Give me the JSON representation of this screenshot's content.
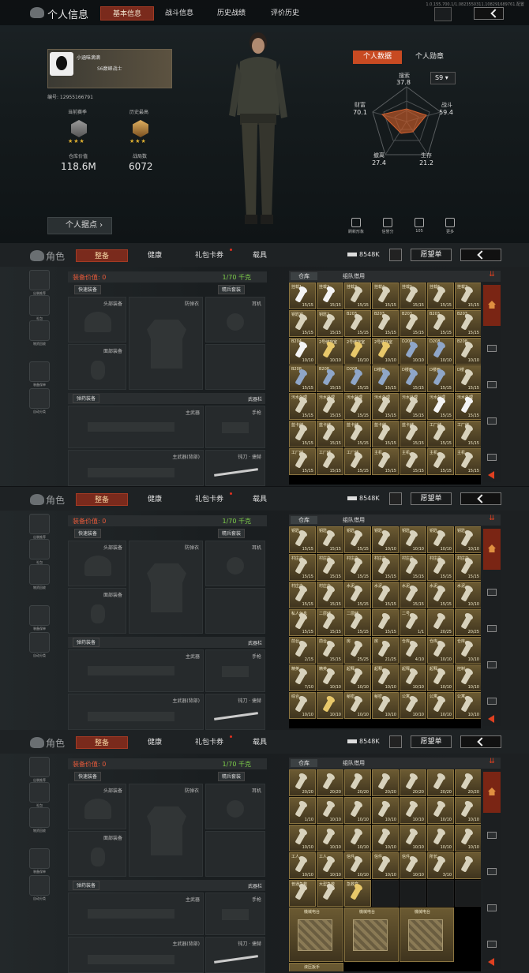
{
  "profile": {
    "title": "个人信息",
    "tabs": [
      "基本信息",
      "战斗信息",
      "历史战绩",
      "评价历史"
    ],
    "sys_info": "1.0.155.700.1/1.0823550311.108291689761.配置",
    "player_name": "小涵味滴滴",
    "player_badge": "S6巅峰战士",
    "player_id": "编号: 12955166791",
    "season_label": "当前赛季",
    "best_label": "历史最高",
    "asset_label": "仓库价值",
    "asset_value": "118.6M",
    "kills_label": "战局数",
    "kills_value": "6072",
    "stars": "★★★",
    "data_tabs": [
      "个人数据",
      "个人勋章"
    ],
    "season_select": "S9",
    "radar": {
      "search_label": "搜索",
      "search_value": "37.8",
      "combat_label": "战斗",
      "combat_value": "59.4",
      "survive_label": "生存",
      "survive_value": "21.2",
      "evac_label": "撤离",
      "evac_value": "27.4",
      "wealth_label": "财富",
      "wealth_value": "70.1"
    },
    "stronghold_btn": "个人据点",
    "quick": [
      {
        "label": "刷新形象",
        "icon": "refresh-icon"
      },
      {
        "label": "信誉分",
        "icon": "shield-icon"
      },
      {
        "label": "105",
        "icon": "thumb-up-icon"
      },
      {
        "label": "更多",
        "icon": "grid-icon"
      }
    ]
  },
  "inventory": {
    "role_title": "角色",
    "tabs": [
      "整备",
      "健康",
      "礼包卡券",
      "载具"
    ],
    "money": "8548K",
    "wish_btn": "愿望单",
    "side": [
      "出装推荐",
      "礼包",
      "物资回收",
      "装备保单",
      "自动分类"
    ],
    "equip_value": "装备价值: 0",
    "weight": "1/70 千克",
    "quick_equip": "快速装备",
    "elite_equip": "精兵套装",
    "slots": {
      "helmet": "头部装备",
      "armor": "防弹衣",
      "ear": "耳机",
      "face": "面部装备",
      "ammo": "弹药装备",
      "weapon_bar": "武器栏",
      "primary": "主武器",
      "pistol": "手枪",
      "primary2": "主武器(背部)",
      "melee": "钝刀 · 捷赫"
    },
    "storage_tabs": [
      "仓库",
      "组队借用"
    ]
  },
  "panels": [
    {
      "items": [
        [
          "挂载1",
          "15/15",
          "white"
        ],
        [
          "挂载2",
          "15/15",
          "white"
        ],
        [
          "挂载3",
          "15/15",
          ""
        ],
        [
          "挂载4",
          "15/15",
          ""
        ],
        [
          "挂载5",
          "15/15",
          ""
        ],
        [
          "挂载6",
          "15/15",
          ""
        ],
        [
          "挂载7",
          "15/15",
          ""
        ],
        [
          "钥匙室",
          "15/15",
          ""
        ],
        [
          "钥匙2",
          "15/15",
          ""
        ],
        [
          "B203",
          "15/15",
          ""
        ],
        [
          "B203",
          "15/15",
          ""
        ],
        [
          "B203",
          "15/15",
          ""
        ],
        [
          "B203",
          "15/15",
          ""
        ],
        [
          "B203",
          "15/15",
          ""
        ],
        [
          "B204",
          "10/10",
          "white"
        ],
        [
          "2号储存室",
          "10/10",
          "yellow"
        ],
        [
          "2号储存室",
          "10/10",
          "yellow"
        ],
        [
          "2号储存室",
          "10/10",
          "yellow"
        ],
        [
          "D208",
          "10/10",
          "blue"
        ],
        [
          "D208",
          "10/10",
          "blue"
        ],
        [
          "B208",
          "10/10",
          ""
        ],
        [
          "B208",
          "15/15",
          "blue"
        ],
        [
          "B208",
          "15/15",
          "blue"
        ],
        [
          "D208",
          "15/15",
          "blue"
        ],
        [
          "D楼西",
          "15/15",
          "blue"
        ],
        [
          "D楼西",
          "15/15",
          "blue"
        ],
        [
          "D楼西",
          "15/15",
          "blue"
        ],
        [
          "D楼",
          "15/15",
          ""
        ],
        [
          "污水处理",
          "15/15",
          ""
        ],
        [
          "污水处理",
          "15/15",
          ""
        ],
        [
          "污水处理",
          "15/15",
          ""
        ],
        [
          "污水处理",
          "15/15",
          ""
        ],
        [
          "污水处理",
          "15/15",
          ""
        ],
        [
          "污水处理",
          "15/15",
          "white"
        ],
        [
          "污水处理",
          "15/15",
          "white"
        ],
        [
          "蓝卡储",
          "15/15",
          ""
        ],
        [
          "蓝卡储",
          "15/15",
          ""
        ],
        [
          "蓝卡储",
          "15/15",
          ""
        ],
        [
          "蓝卡储",
          "15/15",
          ""
        ],
        [
          "蓝卡储",
          "15/15",
          ""
        ],
        [
          "工厂储",
          "15/15",
          ""
        ],
        [
          "工厂储",
          "15/15",
          ""
        ],
        [
          "工厂储",
          "15/15",
          ""
        ],
        [
          "工厂储",
          "15/15",
          ""
        ],
        [
          "工厂储",
          "15/15",
          ""
        ],
        [
          "主机",
          "15/15",
          ""
        ],
        [
          "主机",
          "15/15",
          ""
        ],
        [
          "主机",
          "15/15",
          ""
        ],
        [
          "主机",
          "15/15",
          ""
        ]
      ]
    },
    {
      "items": [
        [
          "钥匙",
          "15/15",
          ""
        ],
        [
          "钥匙",
          "15/15",
          ""
        ],
        [
          "钥匙",
          "15/15",
          ""
        ],
        [
          "钥匙",
          "10/10",
          ""
        ],
        [
          "钥匙",
          "10/10",
          ""
        ],
        [
          "钥匙",
          "10/10",
          ""
        ],
        [
          "钥匙",
          "10/10",
          ""
        ],
        [
          "村庄办",
          "15/15",
          ""
        ],
        [
          "村庄办",
          "15/15",
          ""
        ],
        [
          "村庄办",
          "15/15",
          ""
        ],
        [
          "村庄办",
          "15/15",
          ""
        ],
        [
          "村庄办",
          "15/15",
          ""
        ],
        [
          "村庄办",
          "15/15",
          ""
        ],
        [
          "村庄办",
          "15/15",
          ""
        ],
        [
          "村庄办",
          "15/15",
          ""
        ],
        [
          "村庄办",
          "15/15",
          ""
        ],
        [
          "水泥",
          "15/15",
          ""
        ],
        [
          "水泥",
          "15/15",
          ""
        ],
        [
          "水泥",
          "15/15",
          ""
        ],
        [
          "水泥",
          "15/15",
          ""
        ],
        [
          "水泥",
          "10/10",
          ""
        ],
        [
          "私人休息",
          "15/15",
          ""
        ],
        [
          "二层储",
          "15/15",
          ""
        ],
        [
          "二层储",
          "15/15",
          ""
        ],
        [
          "",
          "15/15",
          ""
        ],
        [
          "二号",
          "1/1",
          ""
        ],
        [
          "",
          "20/25",
          ""
        ],
        [
          "",
          "20/25",
          ""
        ],
        [
          "前台",
          "2/15",
          ""
        ],
        [
          "前台",
          "15/15",
          ""
        ],
        [
          "房",
          "25/25",
          ""
        ],
        [
          "房",
          "21/25",
          ""
        ],
        [
          "仓库",
          "4/10",
          ""
        ],
        [
          "仓库",
          "10/10",
          ""
        ],
        [
          "仓库",
          "10/10",
          ""
        ],
        [
          "精英",
          "7/10",
          ""
        ],
        [
          "精英",
          "10/10",
          ""
        ],
        [
          "起释",
          "10/10",
          ""
        ],
        [
          "起释",
          "10/10",
          ""
        ],
        [
          "起释",
          "10/10",
          ""
        ],
        [
          "起释",
          "10/10",
          ""
        ],
        [
          "控制",
          "10/10",
          ""
        ],
        [
          "综合",
          "10/10",
          ""
        ],
        [
          "",
          "10/10",
          "yellow"
        ],
        [
          "秘密",
          "10/10",
          ""
        ],
        [
          "秘密",
          "10/10",
          ""
        ],
        [
          "公寓",
          "10/10",
          ""
        ],
        [
          "公寓",
          "10/10",
          ""
        ],
        [
          "公寓",
          "10/10",
          ""
        ]
      ]
    },
    {
      "items": [
        [
          "",
          "20/20",
          ""
        ],
        [
          "",
          "20/20",
          ""
        ],
        [
          "",
          "20/20",
          ""
        ],
        [
          "",
          "20/20",
          ""
        ],
        [
          "",
          "20/20",
          ""
        ],
        [
          "",
          "20/20",
          ""
        ],
        [
          "",
          "20/20",
          ""
        ],
        [
          "",
          "1/10",
          ""
        ],
        [
          "",
          "10/10",
          ""
        ],
        [
          "",
          "10/10",
          ""
        ],
        [
          "",
          "10/10",
          ""
        ],
        [
          "",
          "10/10",
          ""
        ],
        [
          "",
          "10/10",
          ""
        ],
        [
          "",
          "10/10",
          ""
        ],
        [
          "",
          "10/10",
          ""
        ],
        [
          "",
          "10/10",
          ""
        ],
        [
          "",
          "10/10",
          ""
        ],
        [
          "",
          "10/10",
          ""
        ],
        [
          "",
          "10/10",
          ""
        ],
        [
          "",
          "10/10",
          ""
        ],
        [
          "",
          "10/10",
          ""
        ],
        [
          "工人",
          "10/10",
          ""
        ],
        [
          "工人",
          "10/10",
          ""
        ],
        [
          "信件",
          "10/10",
          ""
        ],
        [
          "信件",
          "10/10",
          ""
        ],
        [
          "信件",
          "10/10",
          ""
        ],
        [
          "所长",
          "3/10",
          ""
        ],
        [
          "",
          "",
          ""
        ],
        [
          "普通急救",
          "",
          ""
        ],
        [
          "大型急救",
          "",
          ""
        ],
        [
          "急救盒",
          "",
          "yellow"
        ],
        [
          "",
          "",
          "empty"
        ],
        [
          "",
          "",
          "empty"
        ],
        [
          "",
          "",
          "empty"
        ],
        [
          "",
          "",
          "empty"
        ]
      ]
    }
  ],
  "crates": [
    "機械电台",
    "機械电台",
    "機械电台",
    "液压扳手"
  ]
}
